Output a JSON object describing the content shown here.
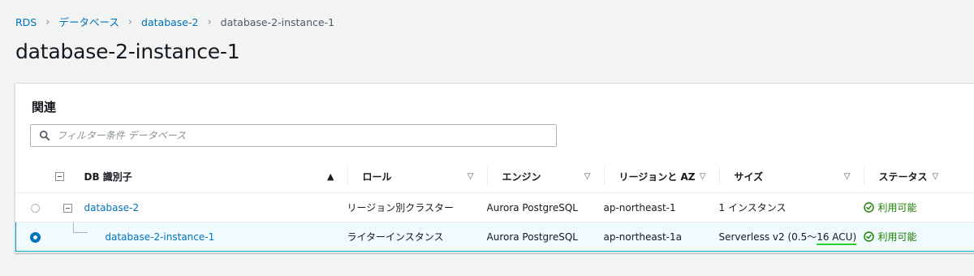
{
  "breadcrumb": {
    "items": [
      "RDS",
      "データベース",
      "database-2"
    ],
    "current": "database-2-instance-1"
  },
  "page_title": "database-2-instance-1",
  "related": {
    "header": "関連",
    "filter_placeholder": "フィルター条件 データベース",
    "columns": [
      "DB 識別子",
      "ロール",
      "エンジン",
      "リージョンと AZ",
      "サイズ",
      "ステータス"
    ],
    "rows": [
      {
        "id": "database-2",
        "role": "リージョン別クラスター",
        "engine": "Aurora PostgreSQL",
        "region": "ap-northeast-1",
        "size": "1 インスタンス",
        "status": "利用可能",
        "selected": false
      },
      {
        "id": "database-2-instance-1",
        "role": "ライターインスタンス",
        "engine": "Aurora PostgreSQL",
        "region": "ap-northeast-1a",
        "size_prefix": "Serverless v2 (0.5～",
        "size_highlight": "16 ACU)",
        "status": "利用可能",
        "selected": true
      }
    ]
  },
  "colors": {
    "link": "#0073bb",
    "status_ok": "#1d8102",
    "selected_border": "#00a1c9",
    "selected_bg": "#f1faff",
    "highlight_underline": "#2bd12b"
  },
  "icons": {
    "breadcrumb_separator": "chevron-right-icon",
    "filter": "search-icon",
    "sort": "caret-down-icon",
    "status": "check-circle-icon"
  }
}
